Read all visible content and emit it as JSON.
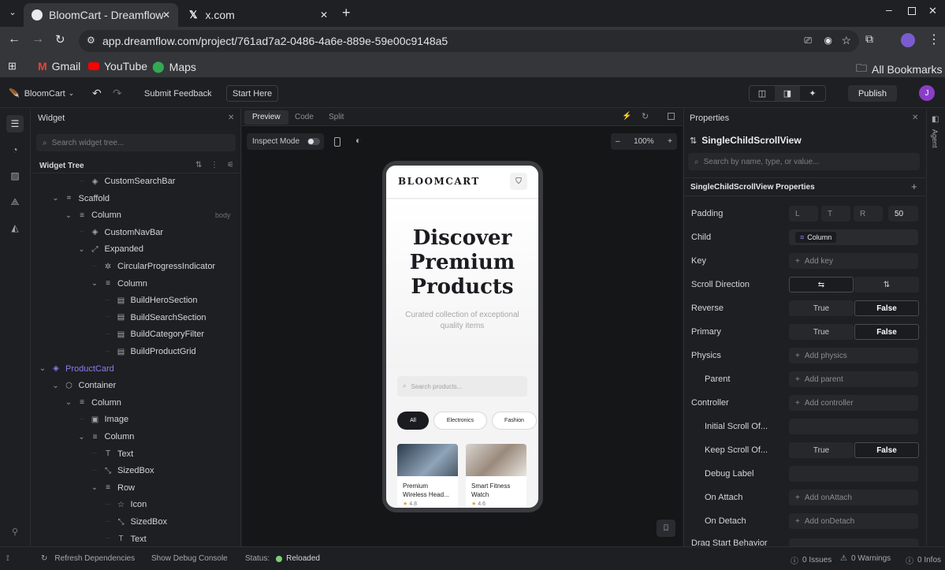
{
  "browser": {
    "tabs": [
      {
        "label": "BloomCart - Dreamflow",
        "active": true
      },
      {
        "label": "x.com",
        "active": false
      }
    ],
    "url": "app.dreamflow.com/project/761ad7a2-0486-4a6e-889e-59e00c9148a5",
    "bookmarks": [
      "Gmail",
      "YouTube",
      "Maps"
    ],
    "all_bookmarks": "All Bookmarks"
  },
  "toolbar": {
    "project": "BloomCart",
    "submit_feedback": "Submit Feedback",
    "start_here": "Start Here",
    "publish": "Publish",
    "avatar_initial": "J"
  },
  "widget_panel": {
    "title": "Widget",
    "search_placeholder": "Search widget tree...",
    "tree_title": "Widget Tree",
    "tree": [
      {
        "label": "CustomSearchBar",
        "indent": 3,
        "chev": "",
        "icon": "◈"
      },
      {
        "label": "Scaffold",
        "indent": 1,
        "chev": "⌄",
        "icon": "⌗"
      },
      {
        "label": "Column",
        "indent": 2,
        "chev": "⌄",
        "icon": "≡",
        "tag": "body"
      },
      {
        "label": "CustomNavBar",
        "indent": 3,
        "chev": "",
        "icon": "◈"
      },
      {
        "label": "Expanded",
        "indent": 3,
        "chev": "⌄",
        "icon": "⤢"
      },
      {
        "label": "CircularProgressIndicator",
        "indent": 4,
        "chev": "",
        "icon": "✲"
      },
      {
        "label": "Column",
        "indent": 4,
        "chev": "⌄",
        "icon": "≡"
      },
      {
        "label": "BuildHeroSection",
        "indent": 5,
        "chev": "",
        "icon": "▤"
      },
      {
        "label": "BuildSearchSection",
        "indent": 5,
        "chev": "",
        "icon": "▤"
      },
      {
        "label": "BuildCategoryFilter",
        "indent": 5,
        "chev": "",
        "icon": "▤"
      },
      {
        "label": "BuildProductGrid",
        "indent": 5,
        "chev": "",
        "icon": "▤"
      },
      {
        "label": "ProductCard",
        "indent": 0,
        "chev": "⌄",
        "icon": "◈",
        "highlight": true
      },
      {
        "label": "Container",
        "indent": 1,
        "chev": "⌄",
        "icon": "⬡"
      },
      {
        "label": "Column",
        "indent": 2,
        "chev": "⌄",
        "icon": "≡"
      },
      {
        "label": "Image",
        "indent": 3,
        "chev": "",
        "icon": "▣"
      },
      {
        "label": "Column",
        "indent": 3,
        "chev": "⌄",
        "icon": "≡"
      },
      {
        "label": "Text",
        "indent": 4,
        "chev": "",
        "icon": "T"
      },
      {
        "label": "SizedBox",
        "indent": 4,
        "chev": "",
        "icon": "⤡"
      },
      {
        "label": "Row",
        "indent": 4,
        "chev": "⌄",
        "icon": "≡"
      },
      {
        "label": "Icon",
        "indent": 5,
        "chev": "",
        "icon": "☆"
      },
      {
        "label": "SizedBox",
        "indent": 5,
        "chev": "",
        "icon": "⤡"
      },
      {
        "label": "Text",
        "indent": 5,
        "chev": "",
        "icon": "T"
      }
    ]
  },
  "canvas": {
    "tabs": [
      "Preview",
      "Code",
      "Split"
    ],
    "inspect_mode": "Inspect Mode",
    "zoom": "100%"
  },
  "app_preview": {
    "brand": "BLOOMCART",
    "hero_title_lines": [
      "Discover",
      "Premium",
      "Products"
    ],
    "hero_subtitle": "Curated collection of exceptional quality items",
    "search_placeholder": "Search products...",
    "categories": [
      "All",
      "Electronics",
      "Fashion"
    ],
    "products": [
      {
        "name": "Premium Wireless Head...",
        "rating": "4.8"
      },
      {
        "name": "Smart Fitness Watch",
        "rating": "4.6"
      }
    ]
  },
  "properties": {
    "title": "Properties",
    "widget_name": "SingleChildScrollView",
    "search_placeholder": "Search by name, type, or value...",
    "section_title": "SingleChildScrollView Properties",
    "padding": {
      "label": "Padding",
      "L": "L",
      "T": "T",
      "R": "R",
      "B": "50"
    },
    "child": {
      "label": "Child",
      "value": "Column"
    },
    "key": {
      "label": "Key",
      "value": "Add key"
    },
    "scroll_direction": {
      "label": "Scroll Direction"
    },
    "reverse": {
      "label": "Reverse",
      "true": "True",
      "false": "False"
    },
    "primary": {
      "label": "Primary",
      "true": "True",
      "false": "False"
    },
    "physics": {
      "label": "Physics",
      "value": "Add physics"
    },
    "parent": {
      "label": "Parent",
      "value": "Add parent"
    },
    "controller": {
      "label": "Controller",
      "value": "Add controller"
    },
    "initial_scroll": {
      "label": "Initial Scroll Of..."
    },
    "keep_scroll": {
      "label": "Keep Scroll Of...",
      "true": "True",
      "false": "False"
    },
    "debug_label": {
      "label": "Debug Label"
    },
    "on_attach": {
      "label": "On Attach",
      "value": "Add onAttach"
    },
    "on_detach": {
      "label": "On Detach",
      "value": "Add onDetach"
    },
    "drag_start": {
      "label": "Drag Start Behavior"
    }
  },
  "agent_label": "Agent",
  "status_bar": {
    "refresh": "Refresh Dependencies",
    "debug_console": "Show Debug Console",
    "status_label": "Status:",
    "status_value": "Reloaded",
    "issues": "0 Issues",
    "warnings": "0 Warnings",
    "infos": "0 Infos"
  }
}
